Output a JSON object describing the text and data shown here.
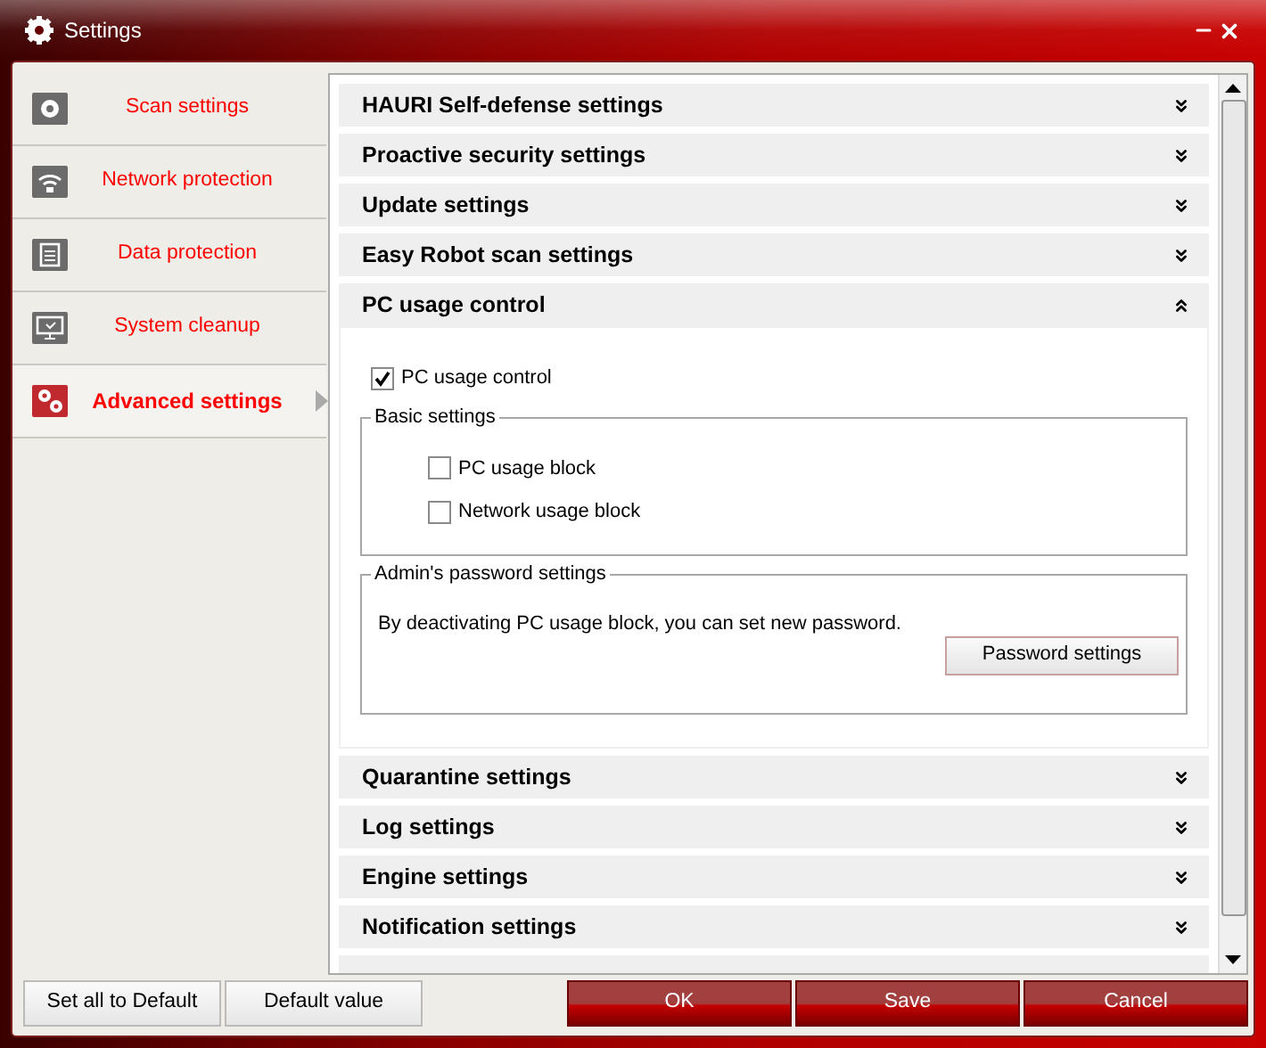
{
  "window": {
    "title": "Settings"
  },
  "sidebar": {
    "items": [
      {
        "label": "Scan settings",
        "selected": false
      },
      {
        "label": "Network protection",
        "selected": false
      },
      {
        "label": "Data protection",
        "selected": false
      },
      {
        "label": "System cleanup",
        "selected": false
      },
      {
        "label": "Advanced settings",
        "selected": true
      }
    ]
  },
  "sections": [
    {
      "title": "HAURI Self-defense settings",
      "expanded": false
    },
    {
      "title": "Proactive security settings",
      "expanded": false
    },
    {
      "title": "Update settings",
      "expanded": false
    },
    {
      "title": "Easy Robot scan settings",
      "expanded": false
    },
    {
      "title": "PC usage control",
      "expanded": true
    },
    {
      "title": "Quarantine settings",
      "expanded": false
    },
    {
      "title": "Log settings",
      "expanded": false
    },
    {
      "title": "Engine settings",
      "expanded": false
    },
    {
      "title": "Notification settings",
      "expanded": false
    }
  ],
  "pc_usage": {
    "enable": {
      "label": "PC usage control",
      "checked": true
    },
    "basic": {
      "title": "Basic settings",
      "options": [
        {
          "label": "PC usage block",
          "checked": false
        },
        {
          "label": "Network usage block",
          "checked": false
        }
      ]
    },
    "admin": {
      "title": "Admin's password settings",
      "text": "By deactivating PC usage block, you can set new password.",
      "button": "Password settings"
    }
  },
  "footer": {
    "left_buttons": [
      "Set all to Default",
      "Default value"
    ],
    "right_buttons": [
      "OK",
      "Save",
      "Cancel"
    ]
  }
}
